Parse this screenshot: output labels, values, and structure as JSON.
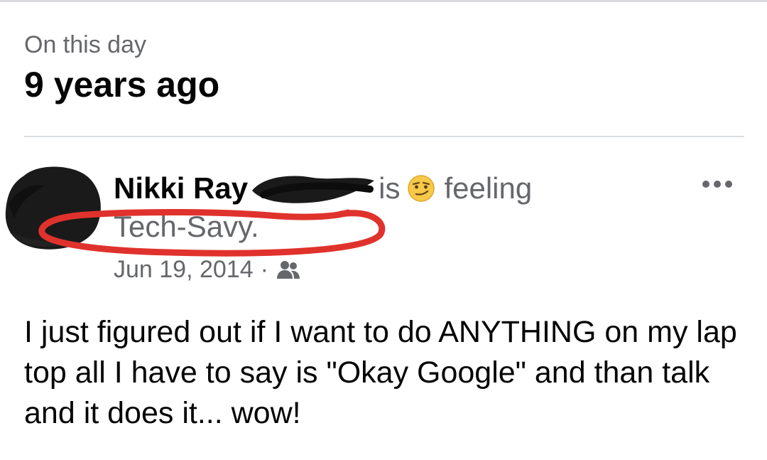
{
  "memory": {
    "eyebrow": "On this day",
    "headline": "9 years ago"
  },
  "post": {
    "author_name": "Nikki Ray",
    "verb": "is",
    "feeling_word": "feeling",
    "feeling_activity": "Tech-Savy.",
    "feeling_emoji_icon": "smirk-emoji-icon",
    "date": "Jun 19, 2014",
    "separator": "·",
    "audience_icon": "friends-icon",
    "more_icon": "more-options-icon",
    "body": "I just figured out if I want to do ANYTHING on my lap top all I have to say is \"Okay Google\" and than talk and it does it... wow!"
  },
  "colors": {
    "primary_text": "#050505",
    "secondary_text": "#65676b",
    "divider": "#dadde1",
    "annotation_red": "#e0322d",
    "redaction": "#1a1a1a"
  }
}
